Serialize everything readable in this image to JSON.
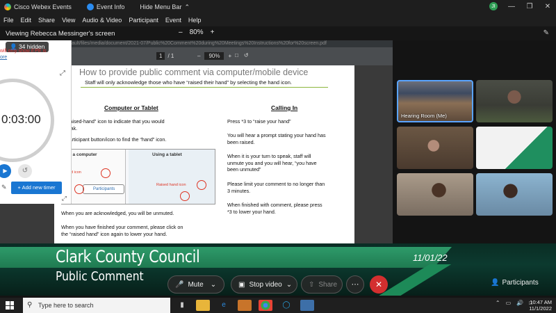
{
  "titlebar": {
    "app_name": "Cisco Webex Events",
    "event_info": "Event Info",
    "hide_menu": "Hide Menu Bar",
    "avatar_initials": "JI"
  },
  "menu": [
    "File",
    "Edit",
    "Share",
    "View",
    "Audio & Video",
    "Participant",
    "Event",
    "Help"
  ],
  "sharebar": {
    "label": "Viewing Rebecca Messinger's screen",
    "zoom": "80%"
  },
  "pdf": {
    "url": "...ontent/default/files/media/document/2021-07/Public%20Comment%20during%20Meetings%20Instructions%20for%20screen.pdf",
    "page_current": "1",
    "page_total": "/ 1",
    "zoom": "90%",
    "title": "How to provide public comment via computer/mobile device",
    "subtitle": "Staff will only acknowledge those who have “raised their hand” by selecting the hand icon.",
    "left_heading": "Computer or Tablet",
    "left_p1": "k the “raised-hand” icon to indicate that you would\n  to speak.",
    "left_p2": "k the participant button/icon to find the “hand” icon.",
    "fig_computer": "ing a computer",
    "fig_tablet": "Using a tablet",
    "fig_hand_icon": "hand icon",
    "fig_raised_icon": "Raised hand icon",
    "fig_participants": "Participants",
    "left_p3": "When you are acknowledged, you will be unmuted.",
    "left_p4": "When you have finished your comment, please click on\nthe “raised hand” icon again to lower your hand.",
    "right_heading": "Calling In",
    "right_p1": "Press *3 to “raise your hand”",
    "right_p2": "You will hear a prompt stating your hand has\nbeen raised.",
    "right_p3": "When it is your turn to speak, staff will\nunmute you and you will hear, “you have\nbeen unmuted”",
    "right_p4": "Please limit your comment to no longer than\n3 minutes.",
    "right_p5": "When finished with comment, please press\n*3 to lower your hand."
  },
  "timer": {
    "hidden": "34 hidden",
    "red_note": "will only show if PE is",
    "more": "ore",
    "time": "0:03:00",
    "add_timer": "Add new timer"
  },
  "videos": {
    "tile1_caption": "Hearing Room (Me)"
  },
  "banner": {
    "title": "Clark County Council",
    "subtitle": "Public Comment",
    "date": "11/01/22"
  },
  "controls": {
    "mute": "Mute",
    "stop_video": "Stop video",
    "share": "Share",
    "participants": "Participants"
  },
  "taskbar": {
    "search_placeholder": "Type here to search",
    "time": "10:47 AM",
    "date": "11/1/2022"
  }
}
